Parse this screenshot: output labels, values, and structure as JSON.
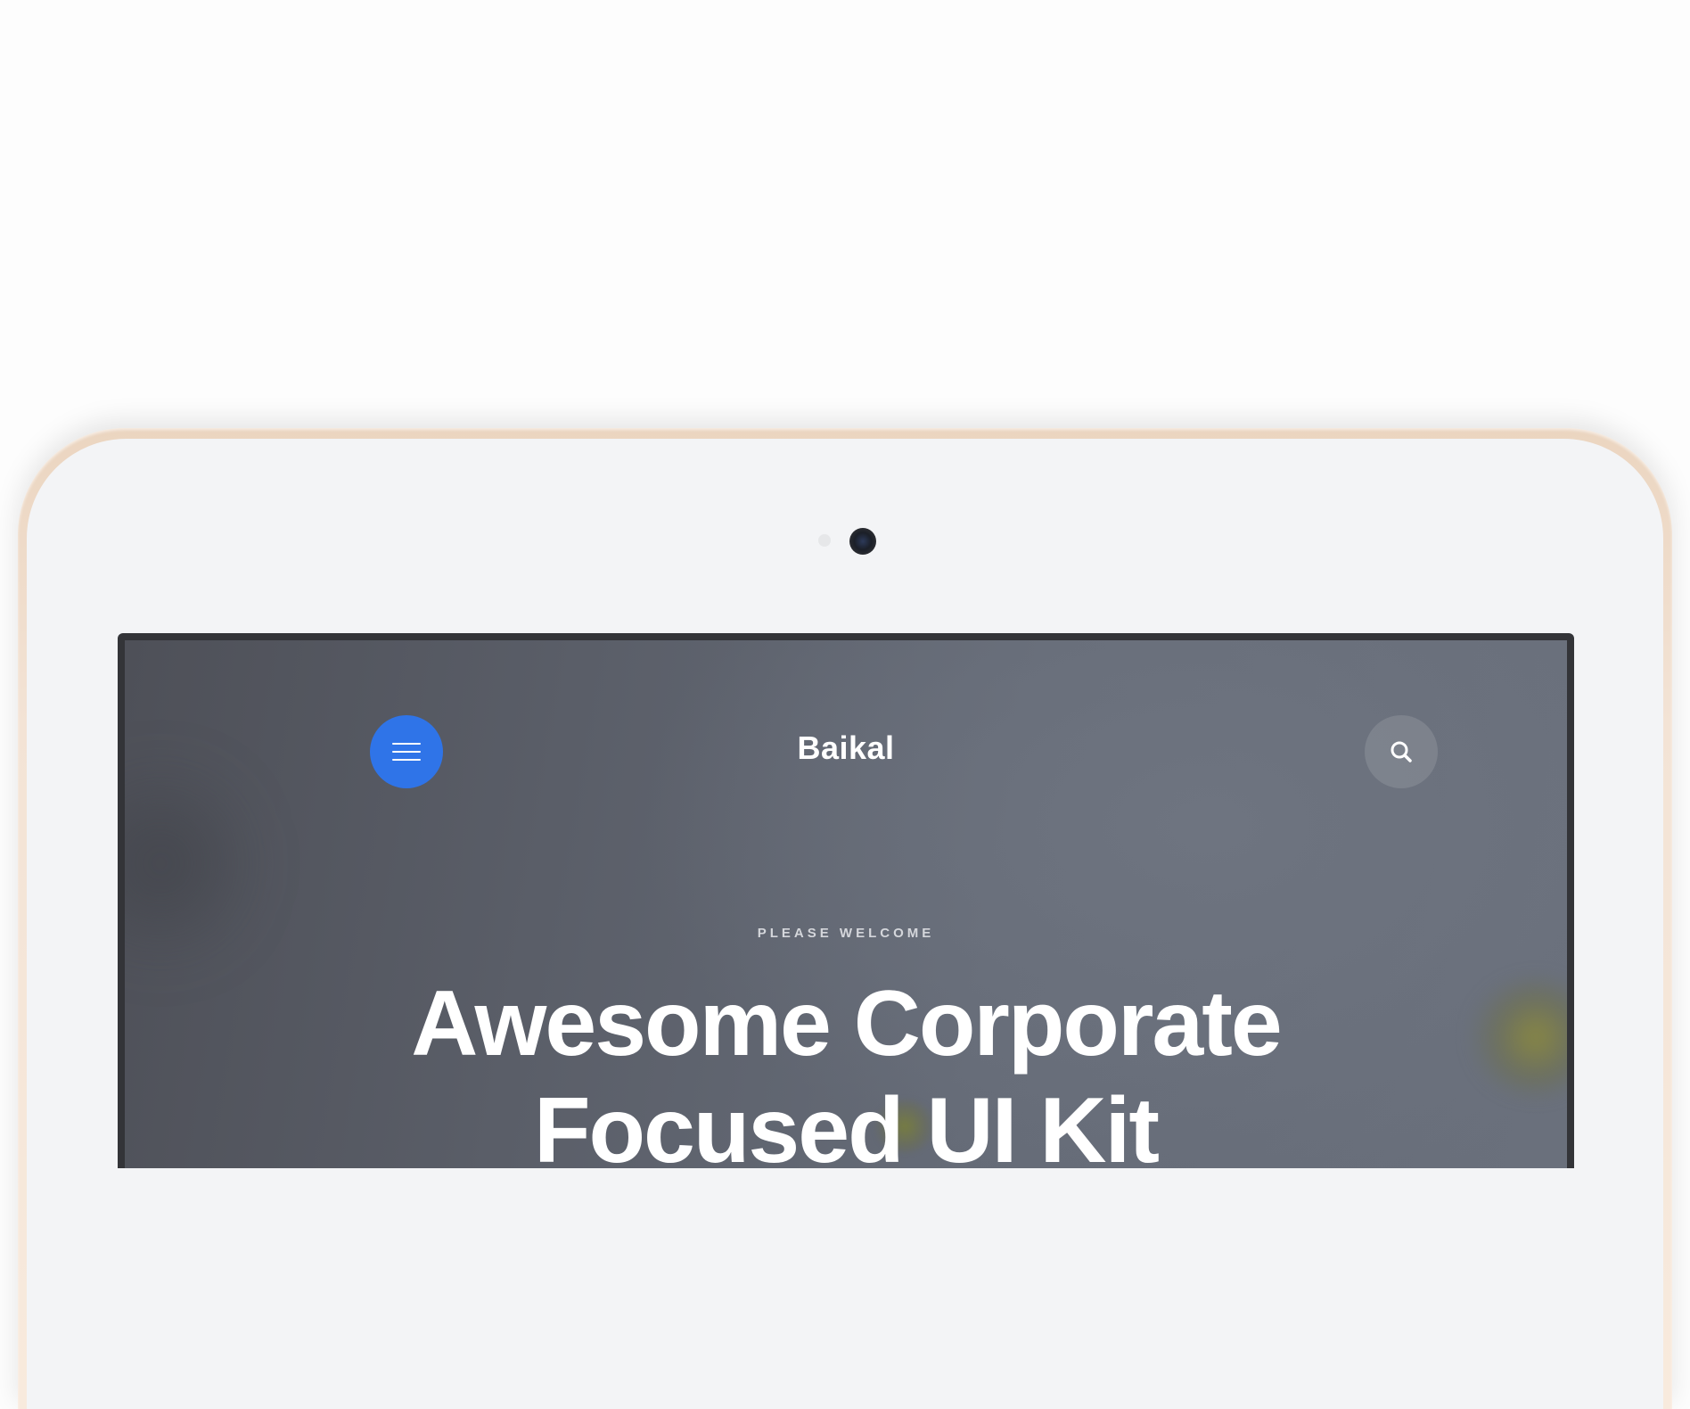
{
  "app": {
    "brand": "Baikal"
  },
  "hero": {
    "eyebrow": "PLEASE WELCOME",
    "title_line1": "Awesome Corporate",
    "title_line2": "Focused UI Kit"
  },
  "header": {
    "menu_icon": "hamburger-menu-icon",
    "search_icon": "search-icon"
  },
  "colors": {
    "accent": "#2f74e8",
    "device_frame": "#ebd5c0",
    "screen_bg": "#5a5e68"
  }
}
